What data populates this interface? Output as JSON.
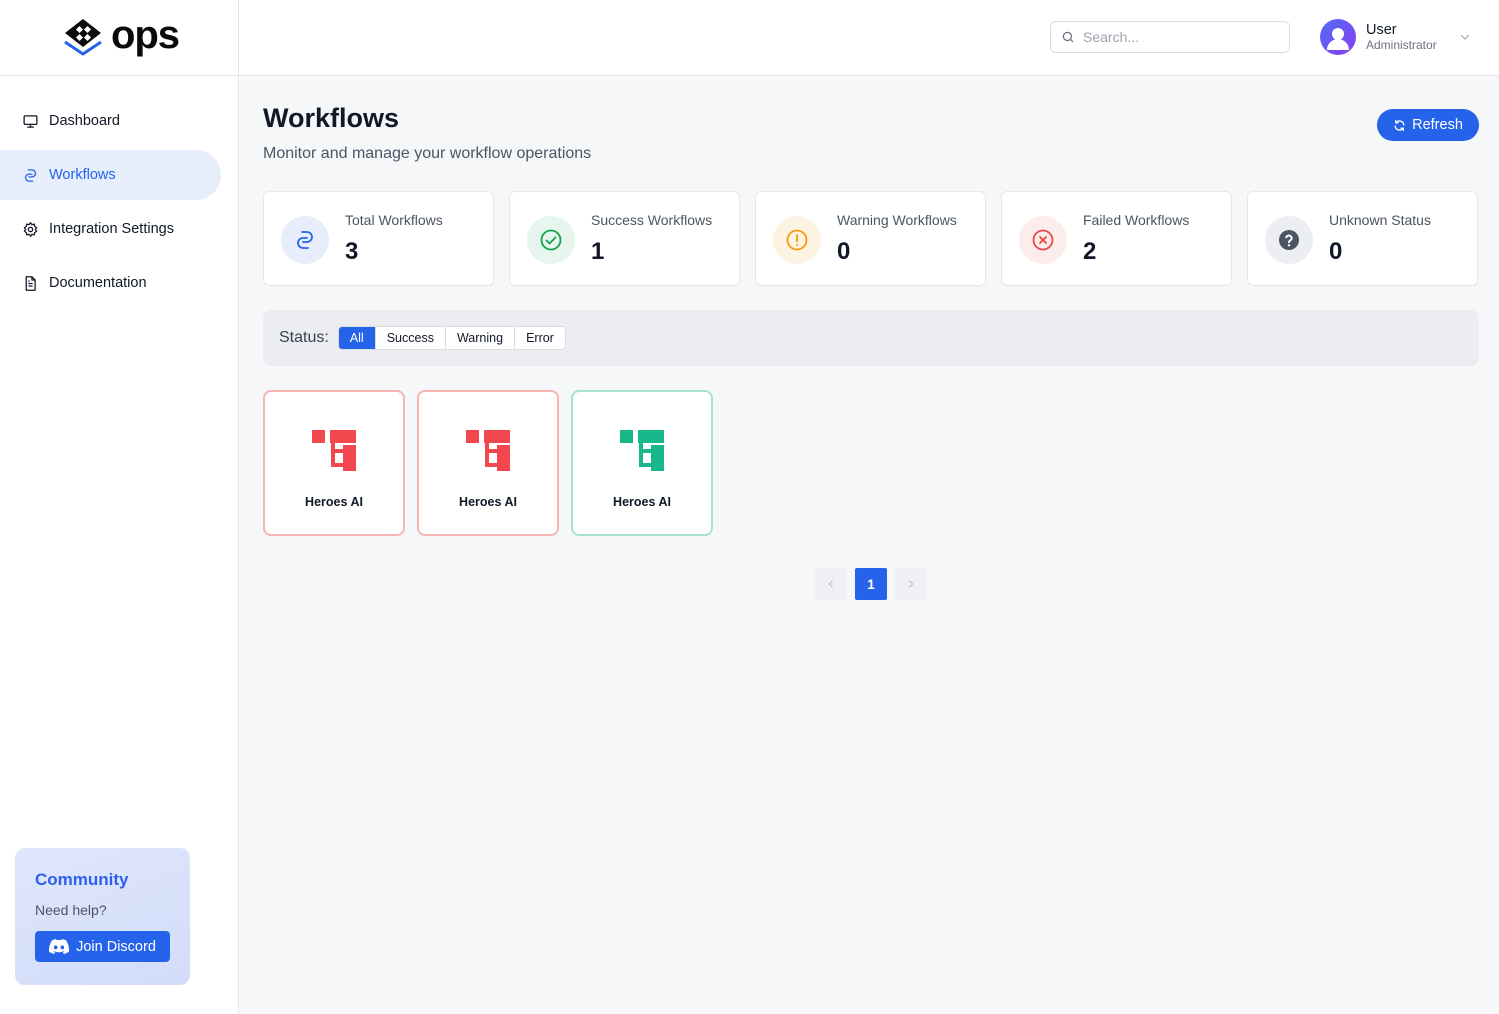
{
  "brand": {
    "name": "ops"
  },
  "sidebar": {
    "items": [
      {
        "label": "Dashboard",
        "icon": "monitor-icon",
        "active": false
      },
      {
        "label": "Workflows",
        "icon": "workflow-icon",
        "active": true
      },
      {
        "label": "Integration Settings",
        "icon": "gear-icon",
        "active": false
      },
      {
        "label": "Documentation",
        "icon": "document-icon",
        "active": false
      }
    ],
    "community": {
      "title": "Community",
      "subtitle": "Need help?",
      "button_label": "Join Discord"
    }
  },
  "header": {
    "search_placeholder": "Search...",
    "user": {
      "name": "User",
      "role": "Administrator"
    }
  },
  "main": {
    "title": "Workflows",
    "subtitle": "Monitor and manage your workflow operations",
    "refresh_label": "Refresh",
    "stats": [
      {
        "label": "Total Workflows",
        "value": "3",
        "color": "#2563eb",
        "bg": "#e8edfb",
        "icon": "workflow-icon"
      },
      {
        "label": "Success Workflows",
        "value": "1",
        "color": "#16a34a",
        "bg": "#e6f6ee",
        "icon": "check-circle-icon"
      },
      {
        "label": "Warning Workflows",
        "value": "0",
        "color": "#f59e0b",
        "bg": "#fdf3e3",
        "icon": "alert-circle-icon"
      },
      {
        "label": "Failed Workflows",
        "value": "2",
        "color": "#ef4444",
        "bg": "#fdecec",
        "icon": "x-circle-icon"
      },
      {
        "label": "Unknown Status",
        "value": "0",
        "color": "#4b5563",
        "bg": "#eceef1",
        "icon": "question-circle-icon"
      }
    ],
    "filter": {
      "label": "Status:",
      "options": [
        "All",
        "Success",
        "Warning",
        "Error"
      ],
      "selected": "All"
    },
    "workflows": [
      {
        "name": "Heroes AI",
        "status": "error",
        "color": "#f2474f",
        "border": "#f6b4b2"
      },
      {
        "name": "Heroes AI",
        "status": "error",
        "color": "#f2474f",
        "border": "#f6b4b2"
      },
      {
        "name": "Heroes AI",
        "status": "success",
        "color": "#19b88a",
        "border": "#a6e3cf"
      }
    ],
    "pagination": {
      "current_page": "1"
    }
  }
}
